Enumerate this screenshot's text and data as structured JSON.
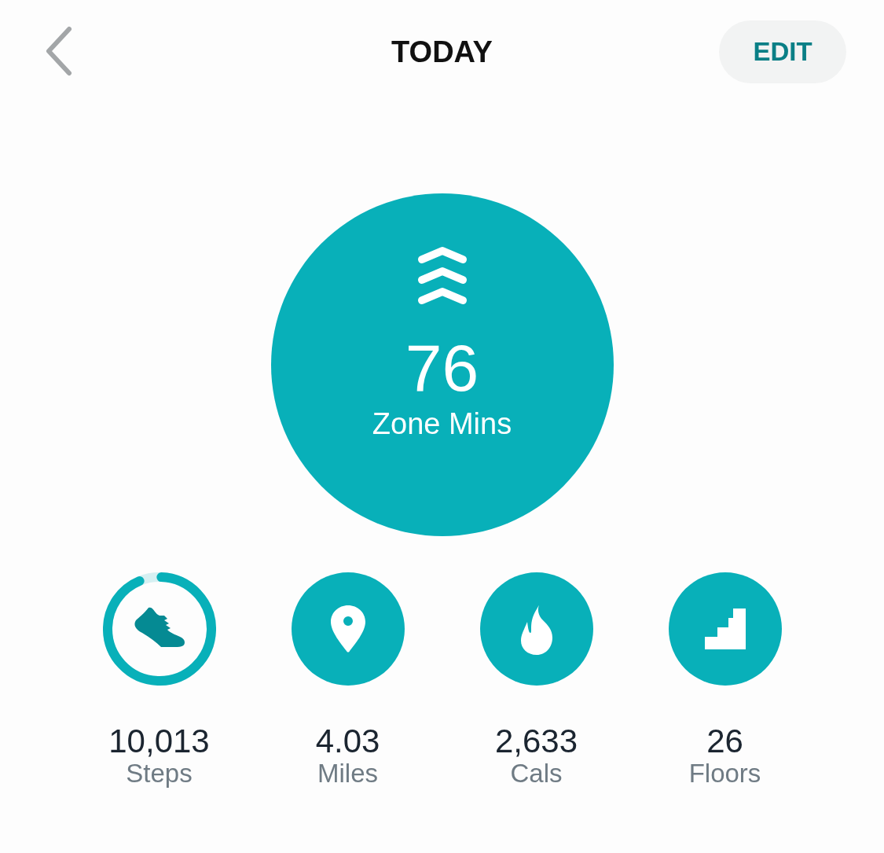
{
  "header": {
    "title": "TODAY",
    "edit_button": "EDIT"
  },
  "zone": {
    "value": "76",
    "label": "Zone Mins"
  },
  "stats": [
    {
      "kind": "ring",
      "level": 0.93,
      "value": "10,013",
      "label": "Steps"
    },
    {
      "kind": "disc",
      "value": "4.03",
      "label": "Miles"
    },
    {
      "kind": "disc",
      "value": "2,633",
      "label": "Cals"
    },
    {
      "kind": "disc",
      "value": "26",
      "label": "Floors"
    }
  ]
}
